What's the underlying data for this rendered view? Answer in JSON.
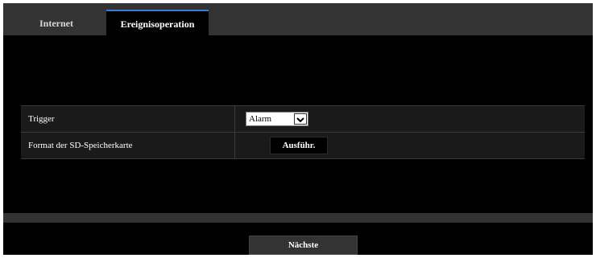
{
  "tabs": [
    {
      "label": "Internet",
      "active": false
    },
    {
      "label": "Ereignisoperation",
      "active": true
    }
  ],
  "settings": {
    "rows": [
      {
        "label": "Trigger",
        "control": "select",
        "value": "Alarm"
      },
      {
        "label": "Format der SD-Speicherkarte",
        "control": "button",
        "button_label": "Ausführ."
      }
    ]
  },
  "footer": {
    "next_label": "Nächste"
  },
  "colors": {
    "background": "#000000",
    "tabbar": "#333333",
    "row": "#1a1a1a",
    "active_tab_accent": "#3a7bd5"
  }
}
